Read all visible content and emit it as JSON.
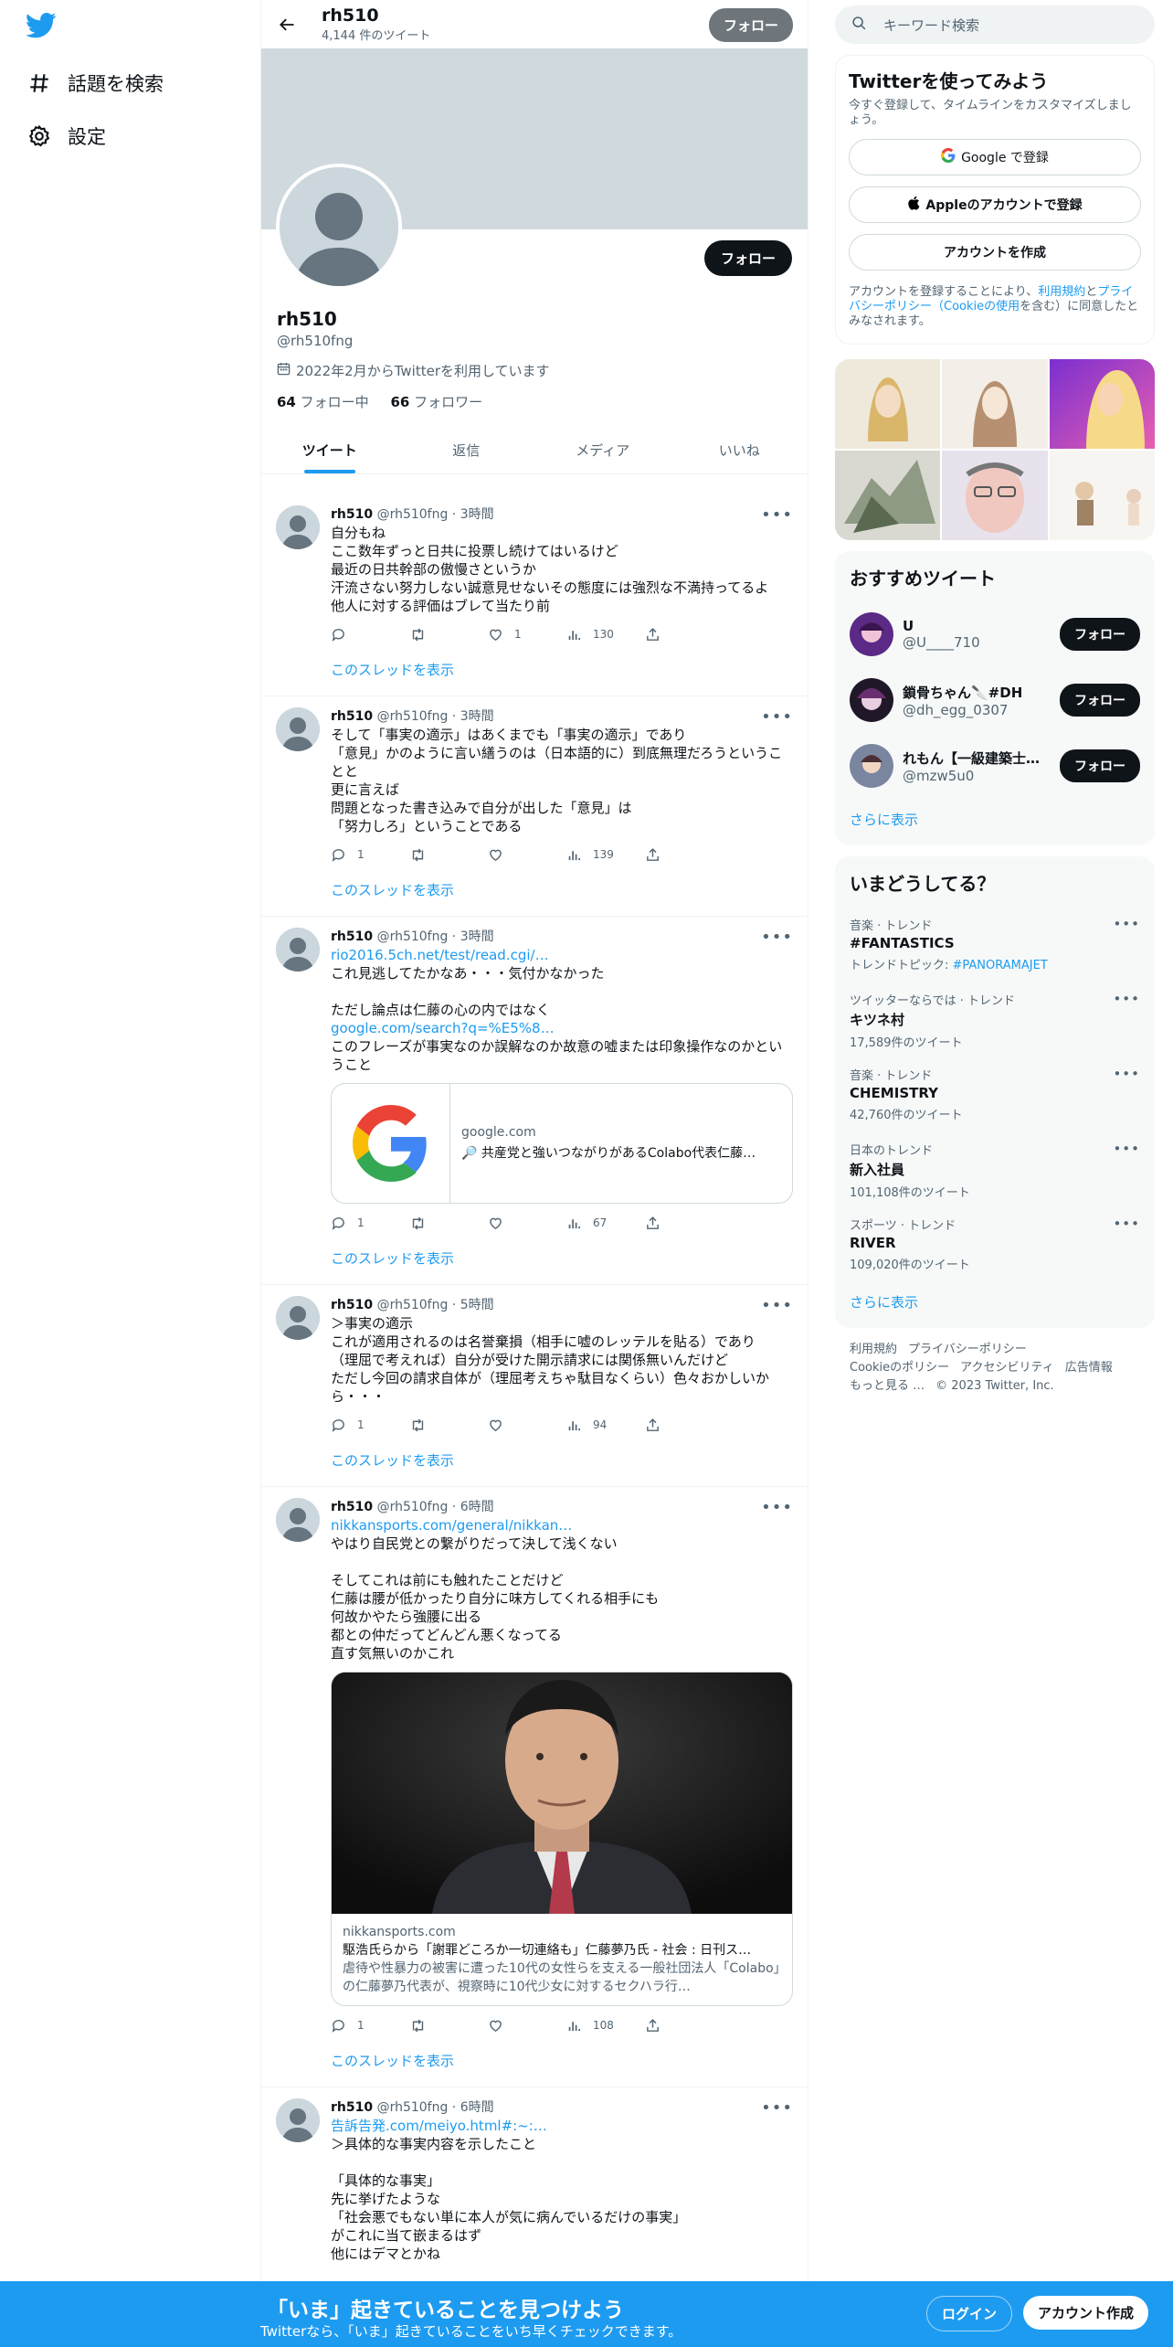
{
  "nav": {
    "explore_label": "話題を検索",
    "settings_label": "設定"
  },
  "header": {
    "name": "rh510",
    "tweet_count": "4,144 件のツイート",
    "follow_label": "フォロー"
  },
  "profile": {
    "name": "rh510",
    "handle": "@rh510fng",
    "joined": "2022年2月からTwitterを利用しています",
    "following_count": "64",
    "following_label": " フォロー中",
    "followers_count": "66",
    "followers_label": " フォロワー",
    "follow_label": "フォロー"
  },
  "tabs": [
    "ツイート",
    "返信",
    "メディア",
    "いいね"
  ],
  "show_thread_label": "このスレッドを表示",
  "tweets": [
    {
      "name": "rh510",
      "handle": "@rh510fng",
      "time": "3時間",
      "text": "自分もね\nここ数年ずっと日共に投票し続けてはいるけど\n最近の日共幹部の傲慢さというか\n汗流さない努力しない誠意見せないその態度には強烈な不満持ってるよ\n他人に対する評価はブレて当たり前",
      "replies": "",
      "retweets": "",
      "likes": "1",
      "views": "130"
    },
    {
      "name": "rh510",
      "handle": "@rh510fng",
      "time": "3時間",
      "text": "そして「事実の適示」はあくまでも「事実の適示」であり\n「意見」かのように言い繕うのは（日本語的に）到底無理だろうということと\n更に言えば\n問題となった書き込みで自分が出した「意見」は\n「努力しろ」ということである",
      "replies": "1",
      "retweets": "",
      "likes": "",
      "views": "139"
    },
    {
      "name": "rh510",
      "handle": "@rh510fng",
      "time": "3時間",
      "link1": "rio2016.5ch.net/test/read.cgi/…",
      "text": "これ見逃してたかなあ・・・気付かなかった\n\nただし論点は仁藤の心の内ではなく",
      "link2": "google.com/search?q=%E5%8…",
      "text2": "このフレーズが事実なのか誤解なのか故意の嘘または印象操作なのかということ",
      "card_domain": "google.com",
      "card_title": "🔎 共産党と強いつながりがあるColabo代表仁藤…",
      "replies": "1",
      "retweets": "",
      "likes": "",
      "views": "67"
    },
    {
      "name": "rh510",
      "handle": "@rh510fng",
      "time": "5時間",
      "text": "＞事実の適示\nこれが適用されるのは名誉棄損（相手に嘘のレッテルを貼る）であり\n（理屈で考えれば）自分が受けた開示請求には関係無いんだけど\nただし今回の請求自体が（理屈考えちゃ駄目なくらい）色々おかしいから・・・",
      "replies": "1",
      "retweets": "",
      "likes": "",
      "views": "94"
    },
    {
      "name": "rh510",
      "handle": "@rh510fng",
      "time": "6時間",
      "link1": "nikkansports.com/general/nikkan…",
      "text": "やはり自民党との繋がりだって決して浅くない\n\nそしてこれは前にも触れたことだけど\n仁藤は腰が低かったり自分に味方してくれる相手にも\n何故かやたら強腰に出る\n都との仲だってどんどん悪くなってる\n直す気無いのかこれ",
      "card_domain": "nikkansports.com",
      "card_title": "駆浩氏らから「謝罪どころか一切連絡も」仁藤夢乃氏 - 社会 : 日刊ス…",
      "card_desc": "虐待や性暴力の被害に遭った10代の女性らを支える一般社団法人「Colabo」の仁藤夢乃代表が、視察時に10代少女に対するセクハラ行…",
      "replies": "1",
      "retweets": "",
      "likes": "",
      "views": "108"
    },
    {
      "name": "rh510",
      "handle": "@rh510fng",
      "time": "6時間",
      "link1": "告訴告発.com/meiyo.html#:~:…",
      "text": "＞具体的な事実内容を示したこと\n\n「具体的な事実」\n先に挙げたような\n「社会悪でもない単に本人が気に病んでいるだけの事実」\nがこれに当て嵌まるはず\n他にはデマとかね"
    }
  ],
  "right": {
    "search_placeholder": "キーワード検索",
    "signup_title": "Twitterを使ってみよう",
    "signup_sub": "今すぐ登録して、タイムラインをカスタマイズしましょう。",
    "google_btn": "Google で登録",
    "apple_btn": "Appleのアカウントで登録",
    "create_btn": "アカウントを作成",
    "legal_pre": "アカウントを登録することにより、",
    "legal_link1": "利用規約",
    "legal_mid1": "と",
    "legal_link2": "プライバシーポリシー",
    "legal_mid2": "（",
    "legal_link3": "Cookieの使用",
    "legal_post": "を含む）に同意したとみなされます。",
    "rec_title": "おすすめツイート",
    "recs": [
      {
        "name": "U",
        "handle": "@U____710",
        "follow": "フォロー"
      },
      {
        "name": "鎖骨ちゃん🔪#DH",
        "handle": "@dh_egg_0307",
        "follow": "フォロー"
      },
      {
        "name": "れもん【一級建築士…",
        "handle": "@mzw5u0",
        "follow": "フォロー"
      }
    ],
    "show_more": "さらに表示",
    "trends_title": "いまどうしてる？",
    "trends": [
      {
        "cat": "音楽 · トレンド",
        "name": "#FANTASTICS",
        "sub_pre": "トレンドトピック: ",
        "sub_link": "#PANORAMAJET"
      },
      {
        "cat": "ツイッターならでは · トレンド",
        "name": "キツネ村",
        "sub": "17,589件のツイート"
      },
      {
        "cat": "音楽 · トレンド",
        "name": "CHEMISTRY",
        "sub": "42,760件のツイート"
      },
      {
        "cat": "日本のトレンド",
        "name": "新入社員",
        "sub": "101,108件のツイート"
      },
      {
        "cat": "スポーツ · トレンド",
        "name": "RIVER",
        "sub": "109,020件のツイート"
      }
    ],
    "footer": [
      "利用規約",
      "プライバシーポリシー",
      "Cookieのポリシー",
      "アクセシビリティ",
      "広告情報",
      "もっと見る …",
      "© 2023 Twitter, Inc."
    ]
  },
  "bottom": {
    "title": "「いま」起きていることを見つけよう",
    "sub": "Twitterなら、「いま」起きていることをいち早くチェックできます。",
    "login": "ログイン",
    "signup": "アカウント作成"
  },
  "colors": {
    "accent": "#1d9bf0",
    "banner": "#cfd9de",
    "text": "#0f1419",
    "muted": "#536471"
  }
}
